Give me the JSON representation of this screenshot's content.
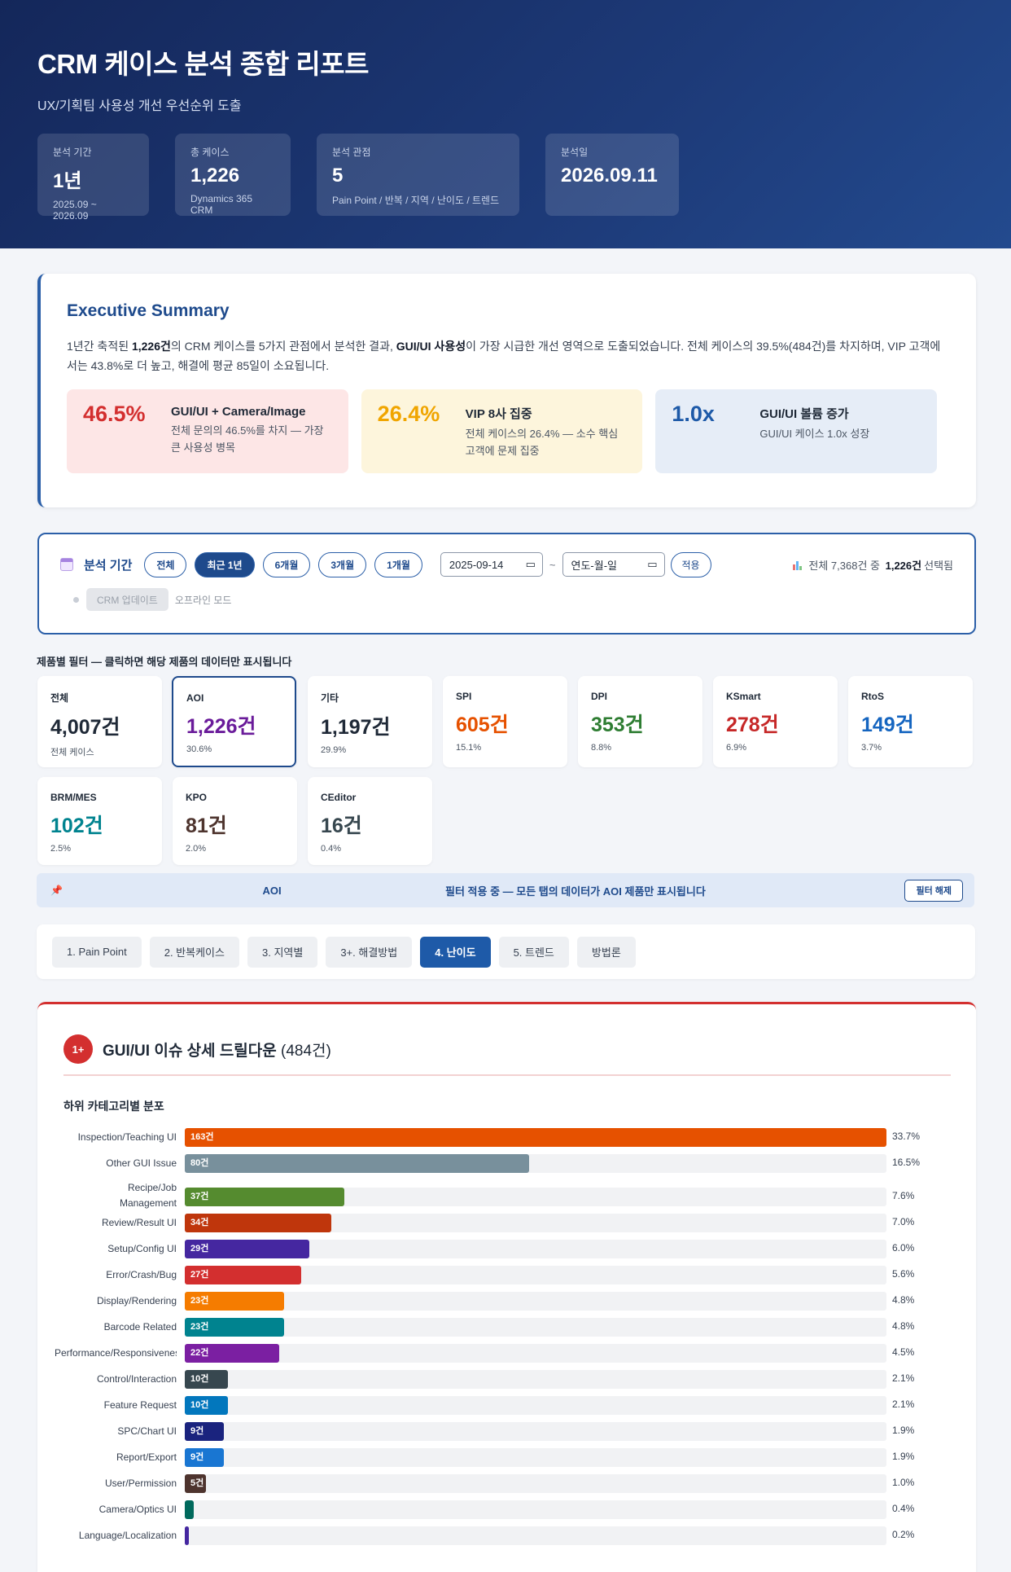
{
  "header": {
    "title": "CRM 케이스 분석 종합 리포트",
    "subtitle": "UX/기획팀 사용성 개선 우선순위 도출",
    "stats": [
      {
        "label": "분석 기간",
        "value": "1년",
        "note": "2025.09 ~ 2026.09"
      },
      {
        "label": "총 케이스",
        "value": "1,226",
        "note": "Dynamics 365 CRM"
      },
      {
        "label": "분석 관점",
        "value": "5",
        "note": "Pain Point / 반복 / 지역 / 난이도 / 트렌드"
      },
      {
        "label": "분석일",
        "value": "2026.09.11",
        "note": ""
      }
    ]
  },
  "summary": {
    "title": "Executive Summary",
    "p1": "1년간 축적된 ",
    "p1_bold": "1,226건",
    "p2": "의 CRM 케이스를 5가지 관점에서 분석한 결과, ",
    "p2_bold": "GUI/UI 사용성",
    "p3": "이 가장 시급한 개선 영역으로 도출되었습니다. 전체 케이스의 39.5%(484건)를 차지하며, VIP 고객에서는 43.8%로 더 높고, 해결에 평균 85일이 소요됩니다.",
    "kpis": [
      {
        "big": "46.5%",
        "title": "GUI/UI + Camera/Image",
        "desc": "전체 문의의 46.5%를 차지 — 가장 큰 사용성 병목",
        "color": "#d32f2f",
        "bg": "#fde6e6"
      },
      {
        "big": "26.4%",
        "title": "VIP 8사 집중",
        "desc": "전체 케이스의 26.4% — 소수 핵심 고객에 문제 집중",
        "color": "#f0a500",
        "bg": "#fdf5dc"
      },
      {
        "big": "1.0x",
        "title": "GUI/UI 볼륨 증가",
        "desc": "GUI/UI 케이스 1.0x 성장",
        "color": "#1e5aa8",
        "bg": "#e6edf7"
      }
    ]
  },
  "period": {
    "title": "분석 기간",
    "presets": [
      "전체",
      "최근 1년",
      "6개월",
      "3개월",
      "1개월"
    ],
    "active_preset": "최근 1년",
    "start_date": "2025-09-14",
    "end_date": "연도-월-일",
    "tilde": "~",
    "apply_label": "적용",
    "sel_prefix": "전체 7,368건 중",
    "sel_bold": "1,226건",
    "sel_suffix": "선택됨",
    "crm_update_label": "CRM 업데이트",
    "offline_label": "오프라인 모드"
  },
  "product_filter": {
    "title": "제품별 필터 — 클릭하면 해당 제품의 데이터만 표시됩니다",
    "cards": [
      {
        "name": "전체",
        "value": "4,007건",
        "pct": "전체 케이스",
        "color": "#1f2937"
      },
      {
        "name": "AOI",
        "value": "1,226건",
        "pct": "30.6%",
        "color": "#6a1b9a"
      },
      {
        "name": "기타",
        "value": "1,197건",
        "pct": "29.9%",
        "color": "#1f2937"
      },
      {
        "name": "SPI",
        "value": "605건",
        "pct": "15.1%",
        "color": "#e65100"
      },
      {
        "name": "DPI",
        "value": "353건",
        "pct": "8.8%",
        "color": "#2e7d32"
      },
      {
        "name": "KSmart",
        "value": "278건",
        "pct": "6.9%",
        "color": "#c62828"
      },
      {
        "name": "RtoS",
        "value": "149건",
        "pct": "3.7%",
        "color": "#1565c0"
      },
      {
        "name": "BRM/MES",
        "value": "102건",
        "pct": "2.5%",
        "color": "#00838f"
      },
      {
        "name": "KPO",
        "value": "81건",
        "pct": "2.0%",
        "color": "#4e342e"
      },
      {
        "name": "CEditor",
        "value": "16건",
        "pct": "0.4%",
        "color": "#37474f"
      }
    ],
    "active": "AOI",
    "notice_product": "AOI",
    "notice_message": "필터 적용 중 — 모든 탭의 데이터가 AOI 제품만 표시됩니다",
    "clear_label": "필터 해제"
  },
  "tabs": {
    "items": [
      "1. Pain Point",
      "2. 반복케이스",
      "3. 지역별",
      "3+. 해결방법",
      "4. 난이도",
      "5. 트렌드",
      "방법론"
    ],
    "active": "4. 난이도"
  },
  "drilldown": {
    "badge": "1+",
    "title": "GUI/UI 이슈 상세 드릴다운",
    "count": "(484건)",
    "subtitle": "하위 카테고리별 분포",
    "max_value": 163,
    "bars": [
      {
        "label": "Inspection/Teaching UI",
        "value": 163,
        "text": "163건",
        "pct": "33.7%",
        "color": "#e65100"
      },
      {
        "label": "Other GUI Issue",
        "value": 80,
        "text": "80건",
        "pct": "16.5%",
        "color": "#78909c"
      },
      {
        "label": "Recipe/Job Management",
        "value": 37,
        "text": "37건",
        "pct": "7.6%",
        "color": "#558b2f"
      },
      {
        "label": "Review/Result UI",
        "value": 34,
        "text": "34건",
        "pct": "7.0%",
        "color": "#bf360c"
      },
      {
        "label": "Setup/Config UI",
        "value": 29,
        "text": "29건",
        "pct": "6.0%",
        "color": "#4527a0"
      },
      {
        "label": "Error/Crash/Bug",
        "value": 27,
        "text": "27건",
        "pct": "5.6%",
        "color": "#d32f2f"
      },
      {
        "label": "Display/Rendering",
        "value": 23,
        "text": "23건",
        "pct": "4.8%",
        "color": "#f57c00"
      },
      {
        "label": "Barcode Related",
        "value": 23,
        "text": "23건",
        "pct": "4.8%",
        "color": "#00838f"
      },
      {
        "label": "Performance/Responsiveness",
        "value": 22,
        "text": "22건",
        "pct": "4.5%",
        "color": "#7b1fa2"
      },
      {
        "label": "Control/Interaction",
        "value": 10,
        "text": "10건",
        "pct": "2.1%",
        "color": "#37474f"
      },
      {
        "label": "Feature Request",
        "value": 10,
        "text": "10건",
        "pct": "2.1%",
        "color": "#0277bd"
      },
      {
        "label": "SPC/Chart UI",
        "value": 9,
        "text": "9건",
        "pct": "1.9%",
        "color": "#1a237e"
      },
      {
        "label": "Report/Export",
        "value": 9,
        "text": "9건",
        "pct": "1.9%",
        "color": "#1976d2"
      },
      {
        "label": "User/Permission",
        "value": 5,
        "text": "5건",
        "pct": "1.0%",
        "color": "#4e342e"
      },
      {
        "label": "Camera/Optics UI",
        "value": 2,
        "text": "",
        "pct": "0.4%",
        "color": "#00695c"
      },
      {
        "label": "Language/Localization",
        "value": 1,
        "text": "",
        "pct": "0.2%",
        "color": "#4527a0"
      }
    ]
  }
}
